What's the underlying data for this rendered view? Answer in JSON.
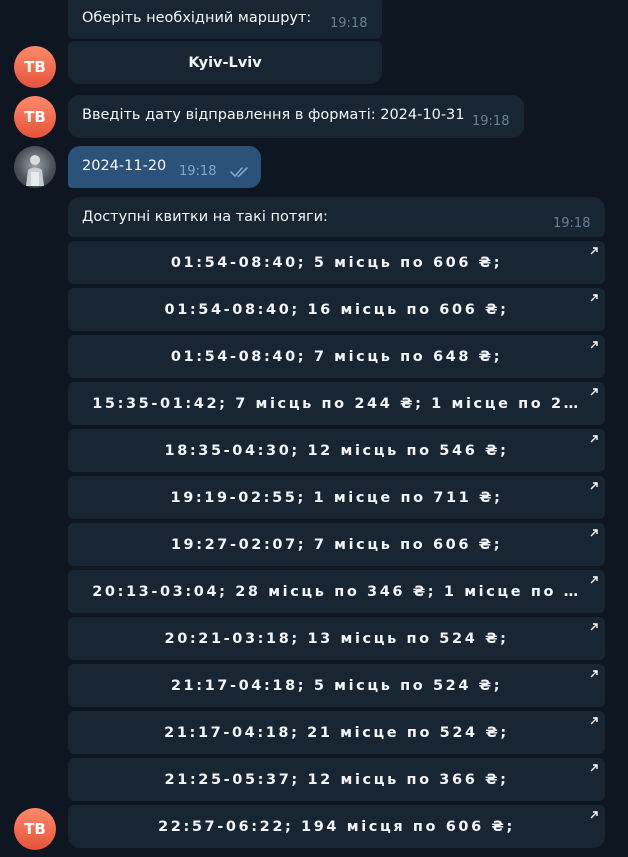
{
  "messages": {
    "route_prompt": {
      "text": "Оберіть необхідний маршрут:",
      "time": "19:18",
      "button": "Kyiv-Lviv"
    },
    "date_prompt": {
      "text": "Введіть дату відправлення в форматі: 2024-10-31",
      "time": "19:18"
    },
    "user_date": {
      "text": "2024-11-20",
      "time": "19:18",
      "status_icon": "double-check-icon"
    },
    "tickets": {
      "text": "Доступні квитки на такі потяги:",
      "time": "19:18"
    }
  },
  "bot_avatar": {
    "initials": "TB",
    "color": "#e9634a"
  },
  "ticket_buttons": [
    "01:54-08:40; 5 місць по 606 ₴;",
    "01:54-08:40; 16 місць по 606 ₴;",
    "01:54-08:40; 7 місць по 648 ₴;",
    "15:35-01:42; 7 місць по 244 ₴; 1 місце по 2…",
    "18:35-04:30; 12 місць по 546 ₴;",
    "19:19-02:55; 1 місце по 711 ₴;",
    "19:27-02:07; 7 місць по 606 ₴;",
    "20:13-03:04; 28 місць по 346 ₴; 1 місце по …",
    "20:21-03:18; 13 місць по 524 ₴;",
    "21:17-04:18; 5 місць по 524 ₴;",
    "21:17-04:18; 21 місце по 524 ₴;",
    "21:25-05:37; 12 місць по 366 ₴;",
    "22:57-06:22; 194 місця по 606 ₴;"
  ],
  "colors": {
    "background": "#0e1621",
    "incoming_bubble": "#182533",
    "outgoing_bubble": "#2b5278"
  }
}
